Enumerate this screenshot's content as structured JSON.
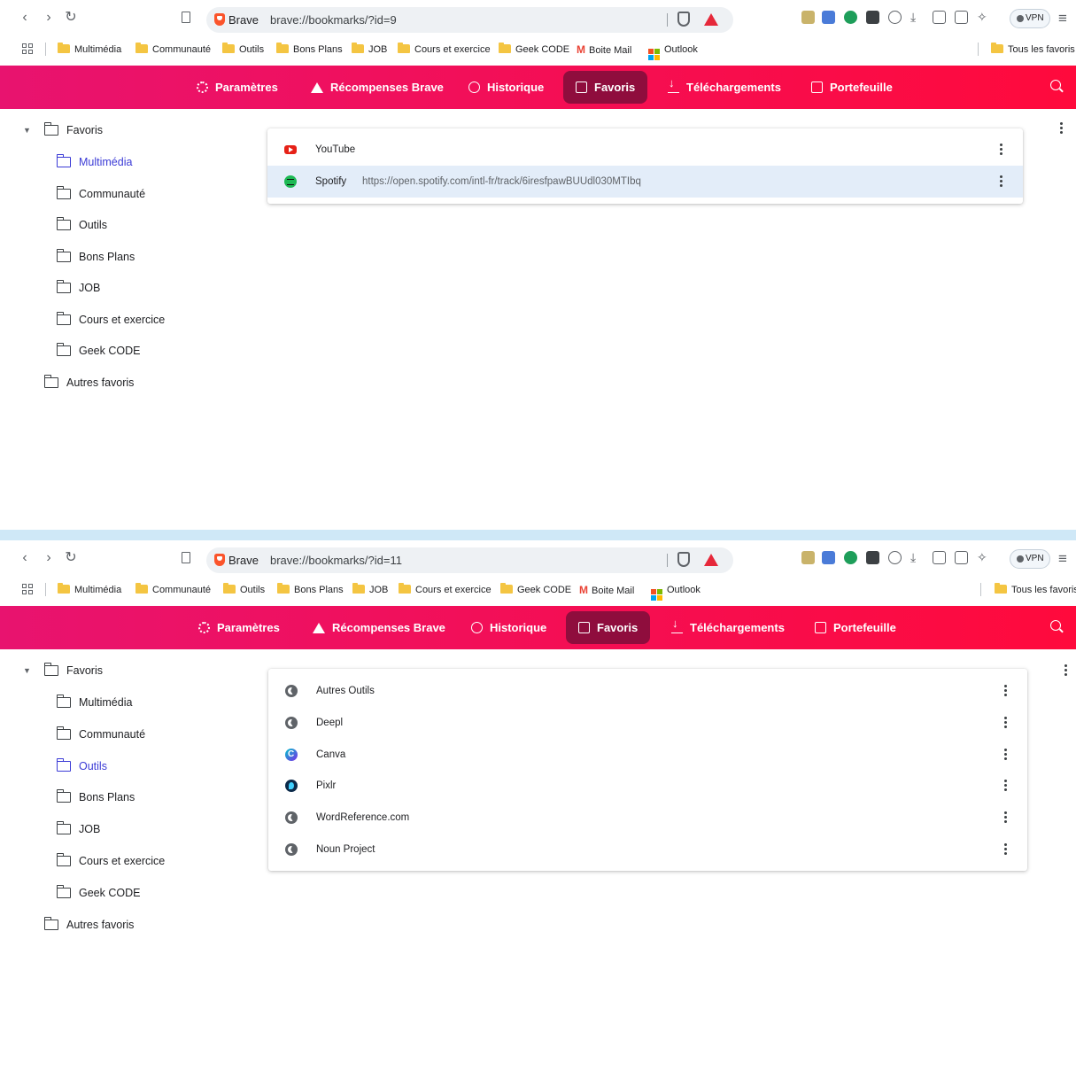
{
  "panels": [
    {
      "omnibox": {
        "brand": "Brave",
        "url": "brave://bookmarks/?id=9"
      },
      "bookmark_bar": {
        "items": [
          "Multimédia",
          "Communauté",
          "Outils",
          "Bons Plans",
          "JOB",
          "Cours et exercice",
          "Geek CODE",
          "Boite Mail",
          "Outlook"
        ],
        "all_bookmarks": "Tous les favoris"
      },
      "vpn_label": "VPN",
      "tabs": [
        "Paramètres",
        "Récompenses Brave",
        "Historique",
        "Favoris",
        "Téléchargements",
        "Portefeuille"
      ],
      "active_tab": "Favoris",
      "tree": {
        "root": "Favoris",
        "children": [
          "Multimédia",
          "Communauté",
          "Outils",
          "Bons Plans",
          "JOB",
          "Cours et exercice",
          "Geek CODE"
        ],
        "other": "Autres favoris",
        "selected": "Multimédia"
      },
      "list": [
        {
          "title": "YouTube",
          "url": "",
          "icon": "youtube-icon"
        },
        {
          "title": "Spotify",
          "url": "https://open.spotify.com/intl-fr/track/6iresfpawBUUdl030MTIbq",
          "icon": "spotify-icon",
          "highlighted": true
        }
      ]
    },
    {
      "omnibox": {
        "brand": "Brave",
        "url": "brave://bookmarks/?id=11"
      },
      "bookmark_bar": {
        "items": [
          "Multimédia",
          "Communauté",
          "Outils",
          "Bons Plans",
          "JOB",
          "Cours et exercice",
          "Geek CODE",
          "Boite Mail",
          "Outlook"
        ],
        "all_bookmarks": "Tous les favoris"
      },
      "vpn_label": "VPN",
      "tabs": [
        "Paramètres",
        "Récompenses Brave",
        "Historique",
        "Favoris",
        "Téléchargements",
        "Portefeuille"
      ],
      "active_tab": "Favoris",
      "tree": {
        "root": "Favoris",
        "children": [
          "Multimédia",
          "Communauté",
          "Outils",
          "Bons Plans",
          "JOB",
          "Cours et exercice",
          "Geek CODE"
        ],
        "other": "Autres favoris",
        "selected": "Outils"
      },
      "list": [
        {
          "title": "Autres Outils",
          "icon": "globe-icon"
        },
        {
          "title": "Deepl",
          "icon": "globe-icon"
        },
        {
          "title": "Canva",
          "icon": "canva-icon"
        },
        {
          "title": "Pixlr",
          "icon": "pixlr-icon"
        },
        {
          "title": "WordReference.com",
          "icon": "globe-icon"
        },
        {
          "title": "Noun Project",
          "icon": "globe-icon"
        }
      ]
    }
  ],
  "colors": {
    "header_start": "#e8136f",
    "header_end": "#ff0a3c",
    "active_tab": "#8f0d3d",
    "selected_folder": "#3b3bd6",
    "row_highlight": "#e3edf9",
    "page_background": "#cfe8f7"
  }
}
